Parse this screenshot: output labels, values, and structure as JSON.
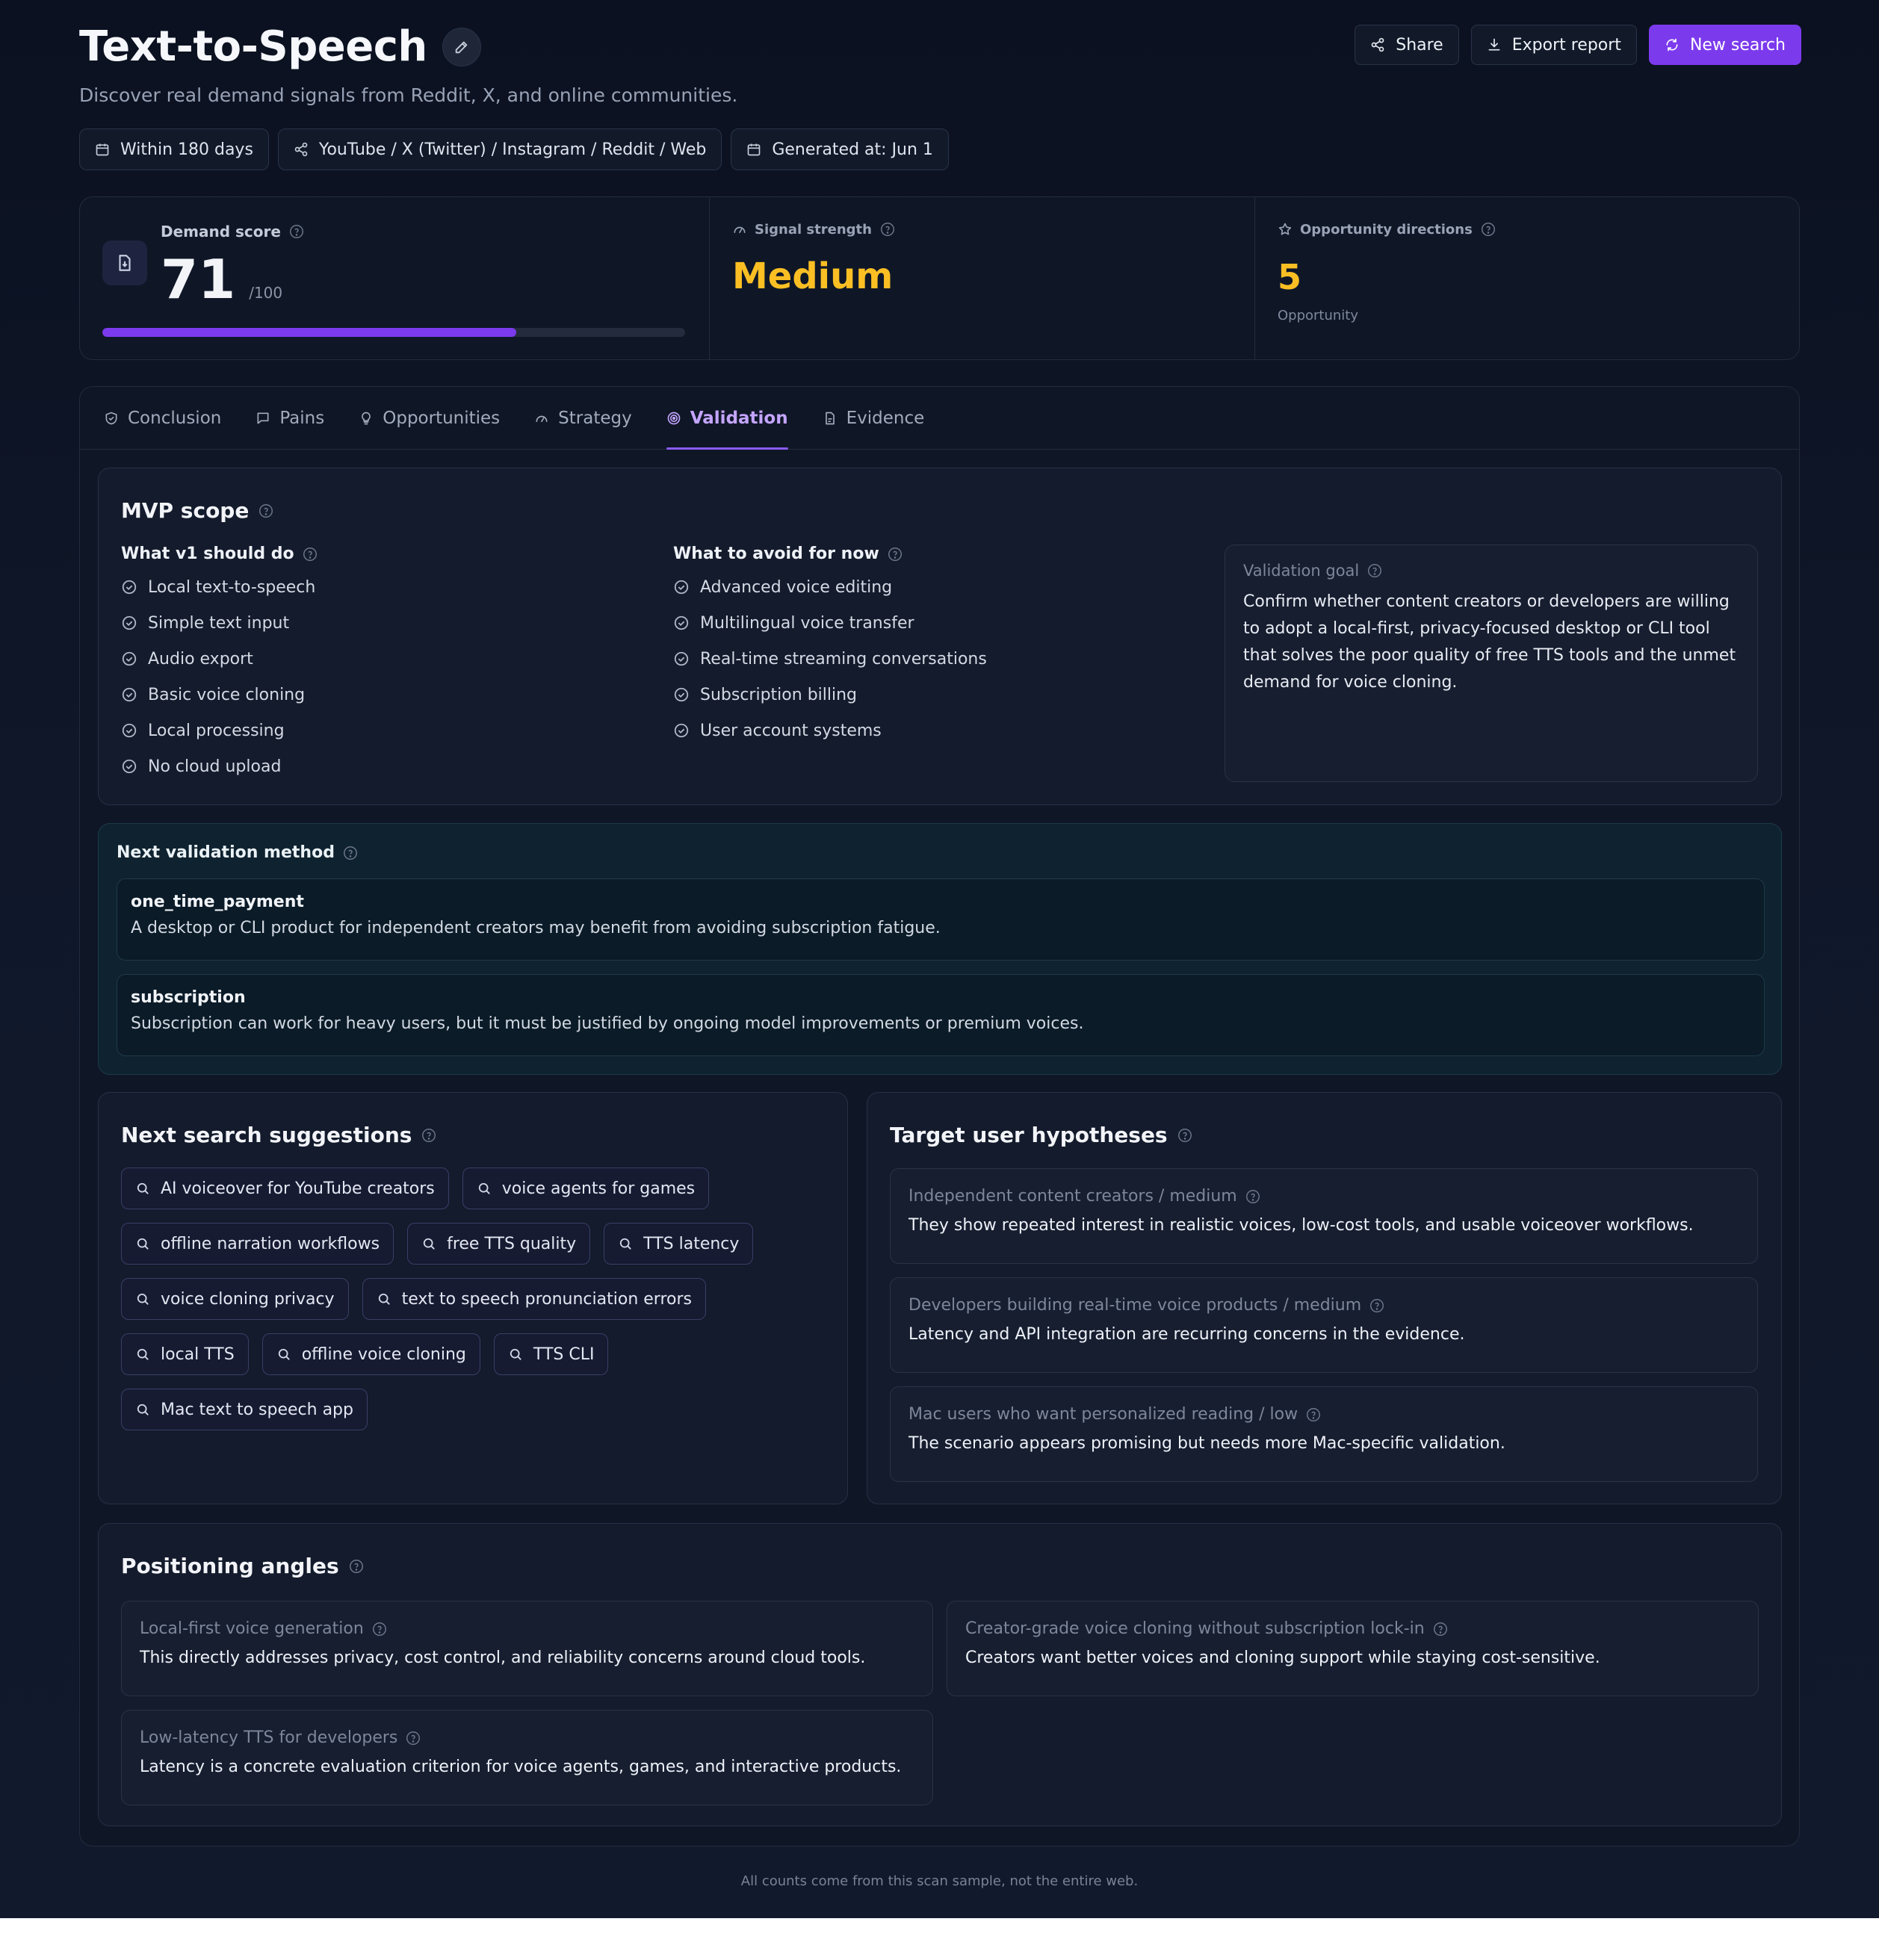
{
  "header": {
    "title": "Text-to-Speech",
    "subtitle": "Discover real demand signals from Reddit, X, and online communities.",
    "meta": {
      "range": "Within 180 days",
      "sources": "YouTube / X (Twitter) / Instagram / Reddit / Web",
      "generated": "Generated at: Jun 1"
    },
    "actions": {
      "share": "Share",
      "export": "Export report",
      "new_search": "New search"
    }
  },
  "stats": {
    "demand": {
      "label": "Demand score",
      "value": "71",
      "max": "/100",
      "progress": 0.71
    },
    "signal": {
      "label": "Signal strength",
      "value": "Medium"
    },
    "opportunity": {
      "label": "Opportunity directions",
      "value": "5",
      "sub": "Opportunity"
    }
  },
  "tabs": [
    "Conclusion",
    "Pains",
    "Opportunities",
    "Strategy",
    "Validation",
    "Evidence"
  ],
  "active_tab": "Validation",
  "mvp": {
    "title": "MVP scope",
    "do_title": "What v1 should do",
    "do_items": [
      "Local text-to-speech",
      "Simple text input",
      "Audio export",
      "Basic voice cloning",
      "Local processing",
      "No cloud upload"
    ],
    "avoid_title": "What to avoid for now",
    "avoid_items": [
      "Advanced voice editing",
      "Multilingual voice transfer",
      "Real-time streaming conversations",
      "Subscription billing",
      "User account systems"
    ],
    "goal_title": "Validation goal",
    "goal_text": "Confirm whether content creators or developers are willing to adopt a local-first, privacy-focused desktop or CLI tool that solves the poor quality of free TTS tools and the unmet demand for voice cloning."
  },
  "next_validation": {
    "title": "Next validation method",
    "methods": [
      {
        "name": "one_time_payment",
        "desc": "A desktop or CLI product for independent creators may benefit from avoiding subscription fatigue."
      },
      {
        "name": "subscription",
        "desc": "Subscription can work for heavy users, but it must be justified by ongoing model improvements or premium voices."
      }
    ]
  },
  "suggestions": {
    "title": "Next search suggestions",
    "items": [
      "AI voiceover for YouTube creators",
      "voice agents for games",
      "offline narration workflows",
      "free TTS quality",
      "TTS latency",
      "voice cloning privacy",
      "text to speech pronunciation errors",
      "local TTS",
      "offline voice cloning",
      "TTS CLI",
      "Mac text to speech app"
    ]
  },
  "targets": {
    "title": "Target user hypotheses",
    "items": [
      {
        "head": "Independent content creators / medium",
        "text": "They show repeated interest in realistic voices, low-cost tools, and usable voiceover workflows."
      },
      {
        "head": "Developers building real-time voice products / medium",
        "text": "Latency and API integration are recurring concerns in the evidence."
      },
      {
        "head": "Mac users who want personalized reading / low",
        "text": "The scenario appears promising but needs more Mac-specific validation."
      }
    ]
  },
  "positioning": {
    "title": "Positioning angles",
    "items": [
      {
        "head": "Local-first voice generation",
        "text": "This directly addresses privacy, cost control, and reliability concerns around cloud tools."
      },
      {
        "head": "Creator-grade voice cloning without subscription lock-in",
        "text": "Creators want better voices and cloning support while staying cost-sensitive."
      },
      {
        "head": "Low-latency TTS for developers",
        "text": "Latency is a concrete evaluation criterion for voice agents, games, and interactive products."
      }
    ]
  },
  "footnote": "All counts come from this scan sample, not the entire web.",
  "colors": {
    "accent": "#7c3aed",
    "signal": "#fbbf24",
    "tab_active": "#c4a5ff"
  }
}
